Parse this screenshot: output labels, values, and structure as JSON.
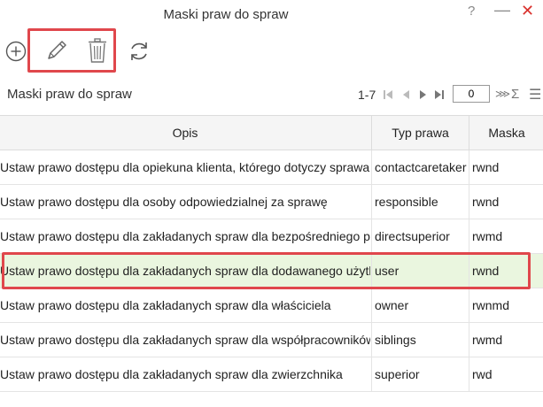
{
  "window": {
    "title": "Maski praw do spraw",
    "help_label": "?",
    "minimize_label": "—",
    "close_label": "✕"
  },
  "toolbar": {
    "icons": [
      "add-circle-icon",
      "pencil-icon",
      "trash-icon",
      "refresh-icon"
    ]
  },
  "section": {
    "title": "Maski praw do spraw"
  },
  "pager": {
    "range": "1-7",
    "page_value": "0",
    "more_label": "⋙",
    "sum_label": "Σ",
    "menu_label": "☰"
  },
  "grid": {
    "columns": [
      "Opis",
      "Typ prawa",
      "Maska"
    ],
    "rows": [
      {
        "opis": "Ustaw prawo dostępu dla opiekuna klienta, którego dotyczy sprawa",
        "typ": "contactcaretaker",
        "maska": "rwnd"
      },
      {
        "opis": "Ustaw prawo dostępu dla osoby odpowiedzialnej za sprawę",
        "typ": "responsible",
        "maska": "rwnd"
      },
      {
        "opis": "Ustaw prawo dostępu dla zakładanych spraw dla bezpośredniego przełożonego",
        "typ": "directsuperior",
        "maska": "rwmd"
      },
      {
        "opis": "Ustaw prawo dostępu dla zakładanych spraw dla dodawanego użytkownika",
        "typ": "user",
        "maska": "rwnd"
      },
      {
        "opis": "Ustaw prawo dostępu dla zakładanych spraw dla właściciela",
        "typ": "owner",
        "maska": "rwnmd"
      },
      {
        "opis": "Ustaw prawo dostępu dla zakładanych spraw dla współpracowników",
        "typ": "siblings",
        "maska": "rwmd"
      },
      {
        "opis": "Ustaw prawo dostępu dla zakładanych spraw dla zwierzchnika",
        "typ": "superior",
        "maska": "rwd"
      }
    ],
    "selected_row": 3
  },
  "colors": {
    "highlight": "#e0474c",
    "selected_row": "#eaf6df",
    "close": "#d9302c"
  }
}
